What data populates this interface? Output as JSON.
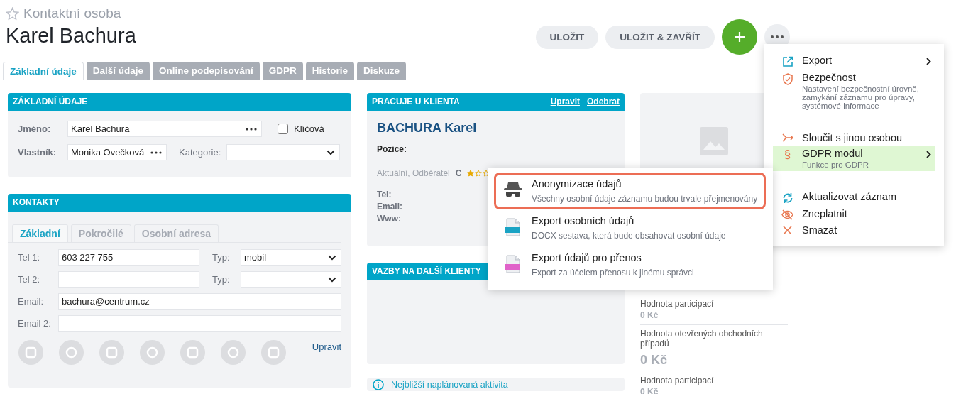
{
  "header": {
    "favorite": false,
    "record_type": "Kontaktní osoba",
    "title": "Karel Bachura",
    "buttons": [
      "ULOŽIT",
      "ULOŽIT & ZAVŘÍT"
    ]
  },
  "tabs": [
    {
      "label": "Základní údaje",
      "selected": true
    },
    {
      "label": "Další údaje",
      "selected": false
    },
    {
      "label": "Online podepisování",
      "selected": false
    },
    {
      "label": "GDPR",
      "selected": false
    },
    {
      "label": "Historie",
      "selected": false
    },
    {
      "label": "Diskuze",
      "selected": false
    }
  ],
  "basic": {
    "title": "ZÁKLADNÍ ÚDAJE",
    "name_label": "Jméno:",
    "name_value": "Karel Bachura",
    "key_label": "Klíčová",
    "key_checked": false,
    "owner_label": "Vlastník:",
    "owner_value": "Monika Ovečková",
    "category_label": "Kategorie:"
  },
  "contacts": {
    "title": "KONTAKTY",
    "tabs": [
      {
        "label": "Základní",
        "selected": true
      },
      {
        "label": "Pokročilé",
        "selected": false
      },
      {
        "label": "Osobní adresa",
        "selected": false
      }
    ],
    "rows": [
      {
        "label": "Tel 1:",
        "value": "603 227 755",
        "type_label": "Typ:",
        "type_value": "mobil"
      },
      {
        "label": "Tel 2:",
        "type_label": "Typ:"
      },
      {
        "label": "Email:",
        "value": "bachura@centrum.cz"
      },
      {
        "label": "Email 2:"
      }
    ],
    "edit_link": "Upravit"
  },
  "client": {
    "title": "PRACUJE U KLIENTA",
    "links": [
      "Upravit",
      "Odebrat"
    ],
    "name": "BACHURA Karel",
    "position_label": "Pozice:",
    "status": "Aktuální, Odběratel",
    "category": "C",
    "stars": 1,
    "fields": [
      "Tel:",
      "Email:",
      "Www:"
    ]
  },
  "relations": {
    "title": "VAZBY NA DALŠÍ KLIENTY"
  },
  "activity": {
    "title": "Nejbližší naplánovaná aktivita"
  },
  "values": [
    {
      "label": "Hodnota participací",
      "value": "0 Kč",
      "kind": "small"
    },
    {
      "label": "Hodnota otevřených obchodních případů",
      "value": "0 Kč",
      "kind": "large"
    },
    {
      "label": "Hodnota participací",
      "value": "0 Kč",
      "kind": "small"
    }
  ],
  "menu": [
    [
      {
        "label": "Export",
        "submenu": true,
        "selected": false
      },
      {
        "label": "Bezpečnost",
        "description": "Nastavení bezpečnostní úrovně, zamykání záznamu pro úpravy, systémové informace",
        "submenu": false,
        "selected": false
      }
    ],
    [
      {
        "label": "Sloučit s jinou osobou",
        "submenu": false,
        "selected": false
      },
      {
        "label": "GDPR modul",
        "icon_glyph": "§",
        "description": "Funkce pro GDPR",
        "submenu": true,
        "selected": true
      }
    ],
    [
      {
        "label": "Aktualizovat záznam",
        "submenu": false,
        "selected": false
      },
      {
        "label": "Zneplatnit",
        "submenu": false,
        "selected": false
      },
      {
        "label": "Smazat",
        "submenu": false,
        "selected": false
      }
    ]
  ],
  "submenu": [
    {
      "label": "Anonymizace údajů",
      "description": "Všechny osobní údaje záznamu budou trvale přejmenovány",
      "selected": true
    },
    {
      "label": "Export osobních údajů",
      "description": "DOCX sestava, která bude obsahovat osobní údaje",
      "selected": false
    },
    {
      "label": "Export údajů pro přenos",
      "description": "Export za účelem přenosu k jinému správci",
      "selected": false
    }
  ]
}
